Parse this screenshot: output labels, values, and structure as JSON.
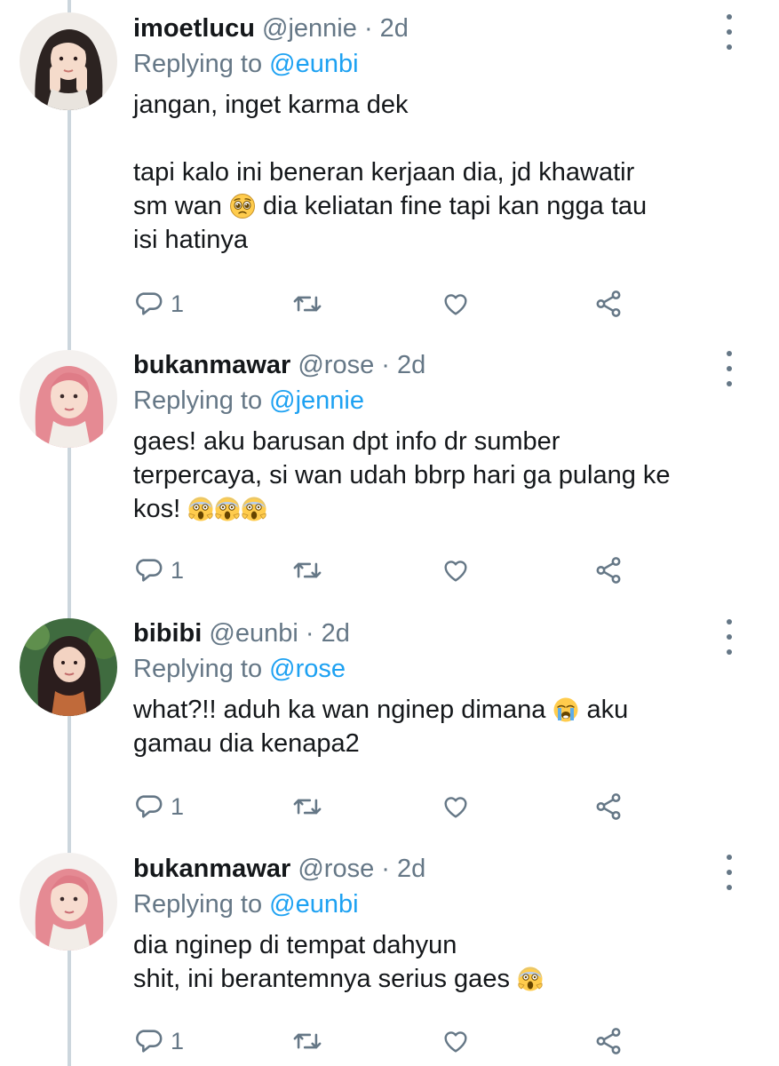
{
  "tweets": [
    {
      "display_name": "imoetlucu",
      "handle": "@jennie",
      "separator": "·",
      "time": "2d",
      "replying_label": "Replying to",
      "replying_to": "@eunbi",
      "text_lines": [
        "jangan, inget karma dek",
        "",
        "tapi kalo ini beneran kerjaan dia, jd khawatir",
        "sm wan 🥺 dia keliatan fine tapi kan ngga tau",
        "isi hatinya"
      ],
      "reply_count": "1",
      "avatar_icon": "avatar-photo-dark-hair"
    },
    {
      "display_name": "bukanmawar",
      "handle": "@rose",
      "separator": "·",
      "time": "2d",
      "replying_label": "Replying to",
      "replying_to": "@jennie",
      "text_lines": [
        "gaes! aku barusan dpt info dr sumber",
        "terpercaya, si wan udah bbrp hari ga pulang ke",
        "kos! 😱😱😱"
      ],
      "reply_count": "1",
      "avatar_icon": "avatar-photo-pink-hair"
    },
    {
      "display_name": "bibibi",
      "handle": "@eunbi",
      "separator": "·",
      "time": "2d",
      "replying_label": "Replying to",
      "replying_to": "@rose",
      "text_lines": [
        "what?!! aduh ka wan nginep dimana 😭 aku",
        "gamau dia kenapa2"
      ],
      "reply_count": "1",
      "avatar_icon": "avatar-photo-long-dark-hair"
    },
    {
      "display_name": "bukanmawar",
      "handle": "@rose",
      "separator": "·",
      "time": "2d",
      "replying_label": "Replying to",
      "replying_to": "@eunbi",
      "text_lines": [
        "dia nginep di tempat dahyun",
        "shit, ini berantemnya serius gaes 😱"
      ],
      "reply_count": "1",
      "avatar_icon": "avatar-photo-pink-hair"
    }
  ],
  "icons": {
    "reply": "reply-icon",
    "retweet": "retweet-icon",
    "like": "like-icon",
    "share": "share-icon",
    "more": "more-options-icon"
  },
  "colors": {
    "text": "#14171a",
    "muted": "#657786",
    "link": "#1da1f2",
    "thread_line": "#ccd6dd"
  }
}
